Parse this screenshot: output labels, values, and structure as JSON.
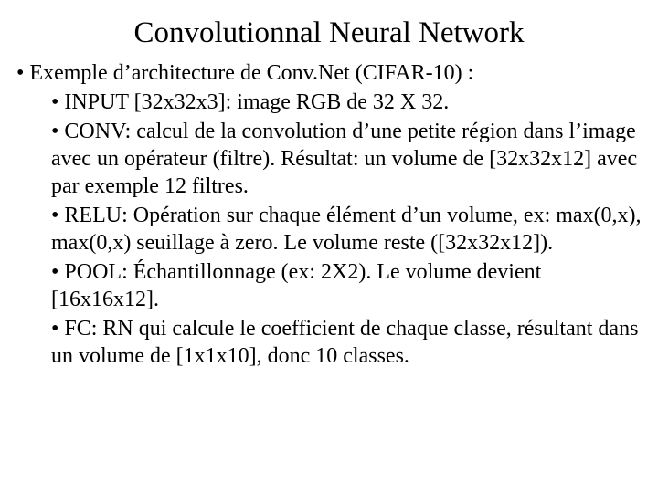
{
  "title": "Convolutionnal Neural Network",
  "bullets": {
    "intro": "• Exemple d’architecture de Conv.Net  (CIFAR-10) :",
    "input": "• INPUT [32x32x3]: image RGB de 32 X 32.",
    "conv": "• CONV: calcul de la convolution d’une petite région dans l’image avec un opérateur (filtre). Résultat: un volume de [32x32x12] avec par exemple 12 filtres.",
    "relu": "• RELU: Opération sur chaque élément d’un volume, ex: max(0,x), max(0,x) seuillage à zero. Le volume reste ([32x32x12]).",
    "pool": "• POOL: Échantillonnage (ex: 2X2). Le volume devient [16x16x12].",
    "fc": "• FC: RN qui calcule le coefficient de chaque classe, résultant dans un volume de [1x1x10], donc 10 classes."
  }
}
